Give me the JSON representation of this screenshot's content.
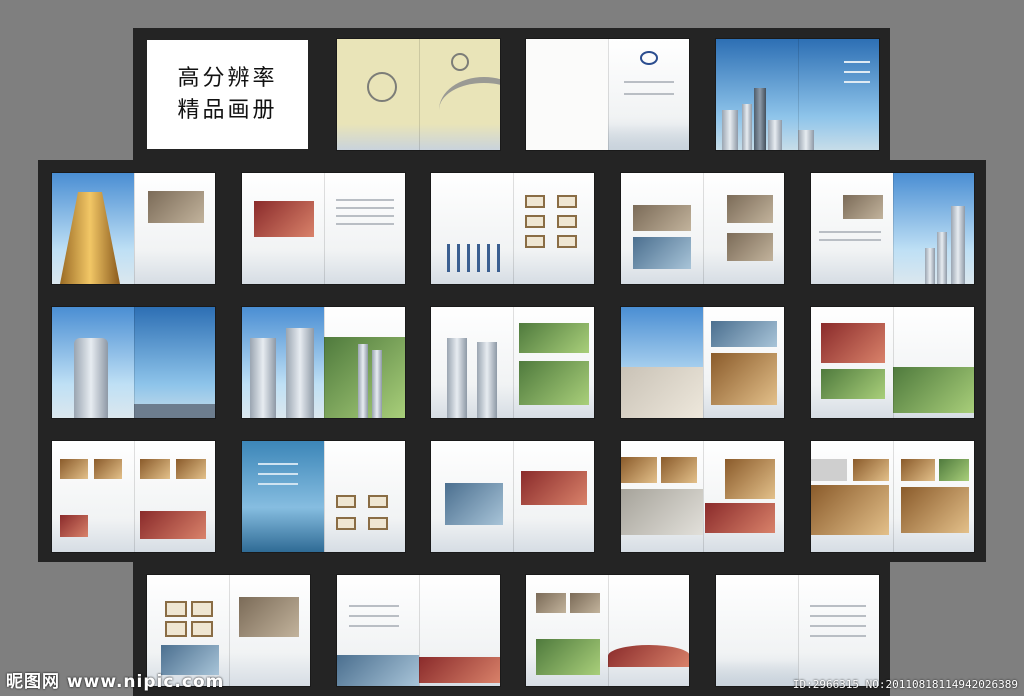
{
  "title_card": {
    "line1": "高分辨率",
    "line2": "精品画册"
  },
  "footer": {
    "site_mark": "昵图网 www.nipic.com",
    "image_id": "ID:2966315 NO:20110818114942026389"
  }
}
